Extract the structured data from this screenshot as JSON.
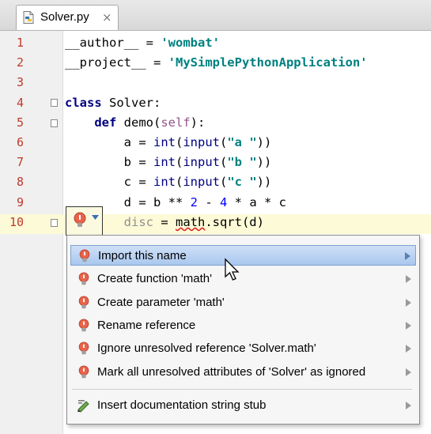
{
  "editor": {
    "tab": {
      "filename": "Solver.py",
      "close": "×",
      "icon": "python-file-icon"
    },
    "lines": [
      {
        "num": "1",
        "tokens": [
          [
            "",
            "__author__ = "
          ],
          [
            "str",
            "'wombat'"
          ]
        ]
      },
      {
        "num": "2",
        "tokens": [
          [
            "",
            "__project__ = "
          ],
          [
            "str",
            "'MySimplePythonApplication'"
          ]
        ]
      },
      {
        "num": "3",
        "tokens": []
      },
      {
        "num": "4",
        "tokens": [
          [
            "kw",
            "class"
          ],
          [
            "",
            " Solver:"
          ]
        ]
      },
      {
        "num": "5",
        "tokens": [
          [
            "",
            "    "
          ],
          [
            "kw",
            "def"
          ],
          [
            "",
            " demo("
          ],
          [
            "self",
            "self"
          ],
          [
            "",
            "):"
          ]
        ]
      },
      {
        "num": "6",
        "tokens": [
          [
            "",
            "        a = "
          ],
          [
            "bi",
            "int"
          ],
          [
            "",
            "("
          ],
          [
            "bi",
            "input"
          ],
          [
            "",
            "("
          ],
          [
            "str",
            "\"a \""
          ],
          [
            "",
            "))"
          ]
        ]
      },
      {
        "num": "7",
        "tokens": [
          [
            "",
            "        b = "
          ],
          [
            "bi",
            "int"
          ],
          [
            "",
            "("
          ],
          [
            "bi",
            "input"
          ],
          [
            "",
            "("
          ],
          [
            "str",
            "\"b \""
          ],
          [
            "",
            "))"
          ]
        ]
      },
      {
        "num": "8",
        "tokens": [
          [
            "",
            "        c = "
          ],
          [
            "bi",
            "int"
          ],
          [
            "",
            "("
          ],
          [
            "bi",
            "input"
          ],
          [
            "",
            "("
          ],
          [
            "str",
            "\"c \""
          ],
          [
            "",
            "))"
          ]
        ]
      },
      {
        "num": "9",
        "tokens": [
          [
            "",
            "        d = b ** "
          ],
          [
            "num",
            "2"
          ],
          [
            "",
            " - "
          ],
          [
            "num",
            "4"
          ],
          [
            "",
            " * a * c"
          ]
        ]
      },
      {
        "num": "10",
        "tokens": [
          [
            "",
            "        "
          ],
          [
            "gray",
            "disc"
          ],
          [
            "",
            " = "
          ],
          [
            "err",
            "math"
          ],
          [
            "",
            ".sqrt(d)"
          ]
        ]
      }
    ]
  },
  "intention_menu": {
    "items": [
      {
        "label": "Import this name",
        "icon": "red-bulb-icon",
        "selected": true
      },
      {
        "label": "Create function 'math'",
        "icon": "red-bulb-icon"
      },
      {
        "label": "Create parameter 'math'",
        "icon": "red-bulb-icon"
      },
      {
        "label": "Rename reference",
        "icon": "red-bulb-icon"
      },
      {
        "label": "Ignore unresolved reference 'Solver.math'",
        "icon": "red-bulb-icon"
      },
      {
        "label": "Mark all unresolved attributes of 'Solver' as ignored",
        "icon": "red-bulb-icon"
      },
      {
        "label": "Insert documentation string stub",
        "icon": "pencil-icon"
      }
    ]
  },
  "colors": {
    "keyword": "#000080",
    "string": "#008080",
    "number": "#0000ff",
    "line_number": "#c0392b",
    "selection": "#a9c7ee"
  }
}
